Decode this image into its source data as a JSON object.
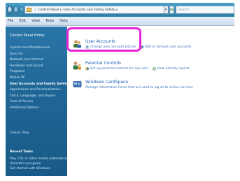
{
  "addressbar": {
    "path": [
      "Control Panel",
      "User Accounts and Family Safety"
    ],
    "search_placeholder": "Search"
  },
  "menubar": [
    "File",
    "Edit",
    "View",
    "Tools",
    "Help"
  ],
  "sidebar": {
    "home": "Control Panel Home",
    "items": [
      "System and Maintenance",
      "Security",
      "Network and Internet",
      "Hardware and Sound",
      "Programs",
      "Mobile PC",
      "User Accounts and Family Safety",
      "Appearance and Personalization",
      "Clock, Language, and Region",
      "Ease of Access",
      "Additional Options"
    ],
    "current_index": 6,
    "classic_view": "Classic View",
    "recent_title": "Recent Tasks",
    "recent": [
      "Play CDs or other media automatically",
      "Uninstall a program",
      "Get started with Windows"
    ]
  },
  "main": {
    "categories": [
      {
        "title": "User Accounts",
        "links": [
          "Change your account picture",
          "Add or remove user accounts"
        ]
      },
      {
        "title": "Parental Controls",
        "links": [
          "Set up parental controls for any user",
          "View activity reports"
        ]
      },
      {
        "title": "Windows CardSpace",
        "links": [
          "Manage Information Cards that are used to log on to online services"
        ]
      }
    ]
  },
  "colors": {
    "highlight": "#ea22d8",
    "sidebar": "#1f6696",
    "link": "#1a5fb4"
  }
}
